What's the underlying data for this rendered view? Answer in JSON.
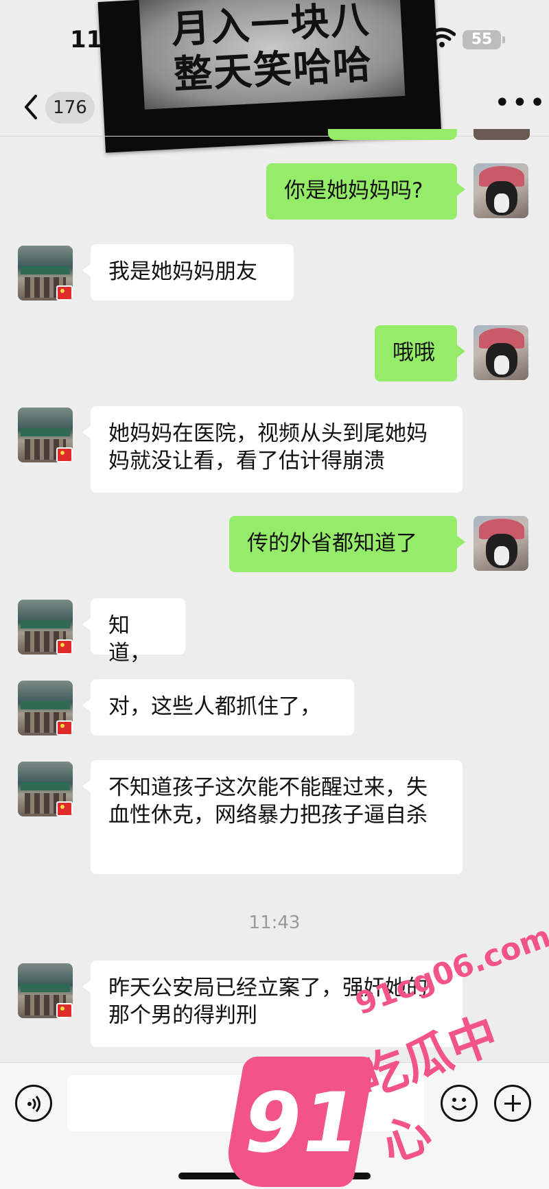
{
  "status_bar": {
    "time": "11:4",
    "battery": "55"
  },
  "meme": {
    "line1": "月入一块八",
    "line2": "整天笑哈哈"
  },
  "nav": {
    "unread_count": "176",
    "more_glyph": "•••"
  },
  "messages": [
    {
      "from": "self",
      "text": "你是她妈妈吗?"
    },
    {
      "from": "other",
      "text": "我是她妈妈朋友"
    },
    {
      "from": "self",
      "text": "哦哦"
    },
    {
      "from": "other",
      "text": "她妈妈在医院，视频从头到尾她妈妈就没让看，看了估计得崩溃"
    },
    {
      "from": "self",
      "text": "传的外省都知道了"
    },
    {
      "from": "other",
      "text": "知道，"
    },
    {
      "from": "other",
      "text": "对，这些人都抓住了，"
    },
    {
      "from": "other",
      "text": "不知道孩子这次能不能醒过来，失血性休克，网络暴力把孩子逼自杀"
    },
    {
      "from": "other",
      "text": "昨天公安局已经立案了，强奸她的那个男的得判刑"
    }
  ],
  "timestamp": "11:43",
  "input": {
    "value": ""
  },
  "watermark": {
    "badge": "91",
    "domain": "91cg06.com",
    "name": "吃瓜中心"
  },
  "colors": {
    "self_bubble": "#95ec69",
    "other_bubble": "#ffffff",
    "background": "#ededed",
    "watermark": "#f2548a"
  }
}
